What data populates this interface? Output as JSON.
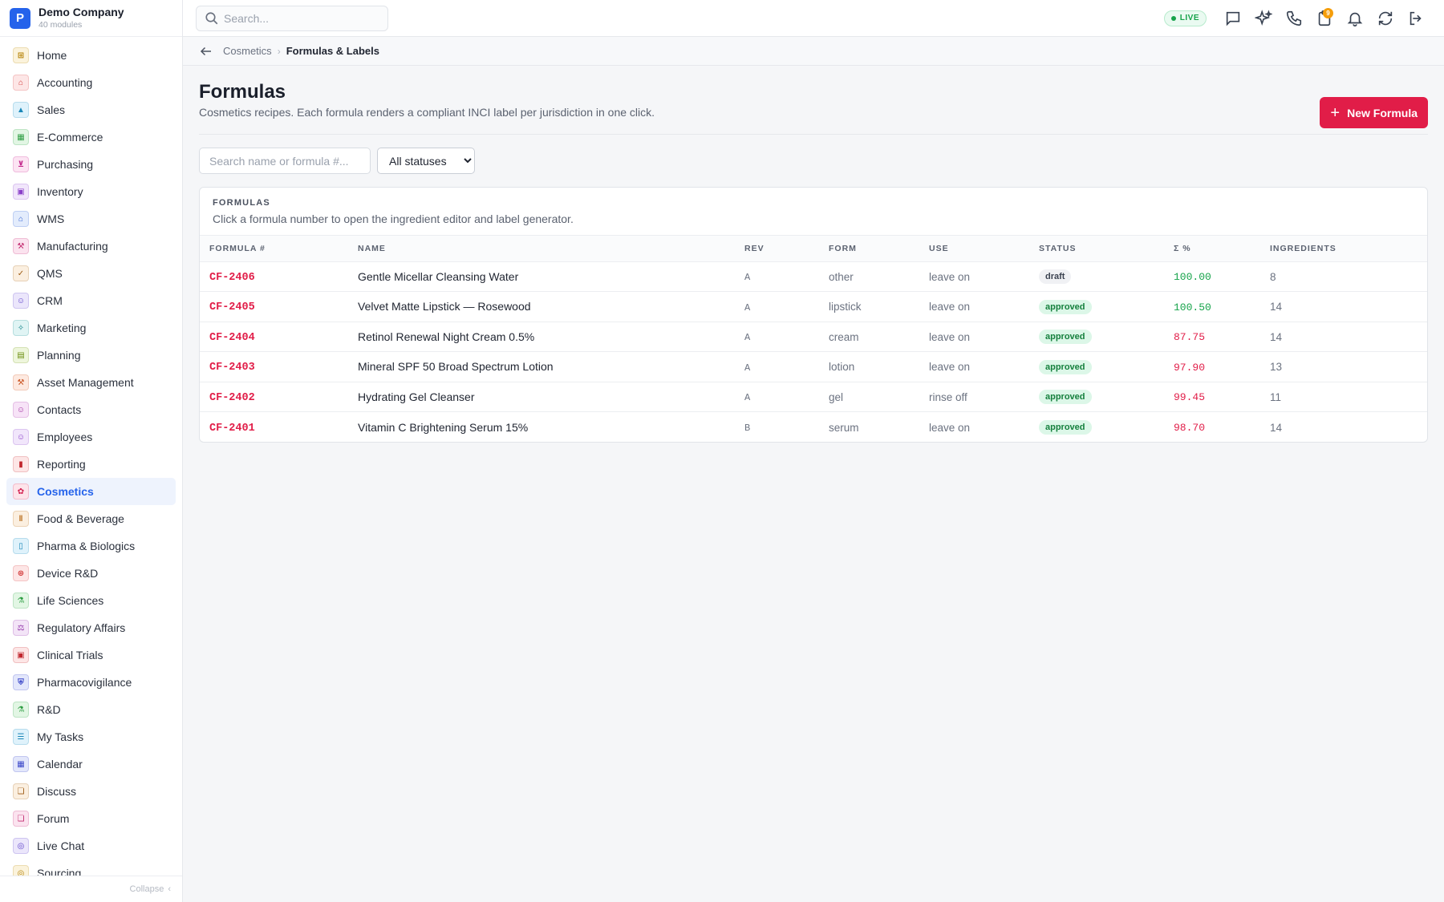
{
  "brand": {
    "initial": "P",
    "name": "Demo Company",
    "sub": "40 modules"
  },
  "sidebar": {
    "items": [
      {
        "label": "Home",
        "icon": "home-icon",
        "glyph": "⊞",
        "bg": "#fbf3dc",
        "fg": "#b58105"
      },
      {
        "label": "Accounting",
        "icon": "bank-icon",
        "glyph": "⌂",
        "bg": "#fde6e6",
        "fg": "#d23b3b"
      },
      {
        "label": "Sales",
        "icon": "sales-icon",
        "glyph": "▲",
        "bg": "#dff2fb",
        "fg": "#1a87b8"
      },
      {
        "label": "E-Commerce",
        "icon": "store-icon",
        "glyph": "▦",
        "bg": "#e2f6e4",
        "fg": "#2f9e44"
      },
      {
        "label": "Purchasing",
        "icon": "cart-icon",
        "glyph": "⊻",
        "bg": "#fce4f3",
        "fg": "#c2258a"
      },
      {
        "label": "Inventory",
        "icon": "box-icon",
        "glyph": "▣",
        "bg": "#f1e6fb",
        "fg": "#8a3fc9"
      },
      {
        "label": "WMS",
        "icon": "warehouse-icon",
        "glyph": "⌂",
        "bg": "#e3ecfc",
        "fg": "#2f5fd0"
      },
      {
        "label": "Manufacturing",
        "icon": "factory-icon",
        "glyph": "⚒",
        "bg": "#fbe3ef",
        "fg": "#c22a6f"
      },
      {
        "label": "QMS",
        "icon": "badge-check-icon",
        "glyph": "✓",
        "bg": "#fbefe0",
        "fg": "#9c5a12"
      },
      {
        "label": "CRM",
        "icon": "users-icon",
        "glyph": "☺",
        "bg": "#ebe6fb",
        "fg": "#5b3fc9"
      },
      {
        "label": "Marketing",
        "icon": "megaphone-icon",
        "glyph": "✧",
        "bg": "#e0f4f4",
        "fg": "#16858a"
      },
      {
        "label": "Planning",
        "icon": "calendar-grid-icon",
        "glyph": "▤",
        "bg": "#eef6dc",
        "fg": "#6d8f12"
      },
      {
        "label": "Asset Management",
        "icon": "tools-icon",
        "glyph": "⚒",
        "bg": "#fde9e0",
        "fg": "#c9521f"
      },
      {
        "label": "Contacts",
        "icon": "contact-card-icon",
        "glyph": "☺",
        "bg": "#f7e3f7",
        "fg": "#a0309f"
      },
      {
        "label": "Employees",
        "icon": "employee-icon",
        "glyph": "☺",
        "bg": "#f1e6fb",
        "fg": "#8a3fc9"
      },
      {
        "label": "Reporting",
        "icon": "bar-chart-icon",
        "glyph": "▮",
        "bg": "#fde6e6",
        "fg": "#c0262d"
      },
      {
        "label": "Cosmetics",
        "icon": "flower-icon",
        "glyph": "✿",
        "bg": "#fde4ea",
        "fg": "#d21f4f"
      },
      {
        "label": "Food & Beverage",
        "icon": "utensils-icon",
        "glyph": "ǁ",
        "bg": "#fbefe0",
        "fg": "#b5650f"
      },
      {
        "label": "Pharma & Biologics",
        "icon": "pill-bottle-icon",
        "glyph": "▯",
        "bg": "#dff2fb",
        "fg": "#1a87b8"
      },
      {
        "label": "Device R&D",
        "icon": "chip-icon",
        "glyph": "⊛",
        "bg": "#fde6e6",
        "fg": "#d23b3b"
      },
      {
        "label": "Life Sciences",
        "icon": "microscope-icon",
        "glyph": "⚗",
        "bg": "#e2f6e4",
        "fg": "#2f9e44"
      },
      {
        "label": "Regulatory Affairs",
        "icon": "gavel-icon",
        "glyph": "⚖",
        "bg": "#f3e4f7",
        "fg": "#8f2fa6"
      },
      {
        "label": "Clinical Trials",
        "icon": "clipboard-icon",
        "glyph": "▣",
        "bg": "#fde6e6",
        "fg": "#c0262d"
      },
      {
        "label": "Pharmacovigilance",
        "icon": "shield-icon",
        "glyph": "⛨",
        "bg": "#e3e7fb",
        "fg": "#3b47c9"
      },
      {
        "label": "R&D",
        "icon": "flask-icon",
        "glyph": "⚗",
        "bg": "#e2f6e4",
        "fg": "#2f9e44"
      },
      {
        "label": "My Tasks",
        "icon": "checklist-icon",
        "glyph": "☰",
        "bg": "#dff2fb",
        "fg": "#1a87b8"
      },
      {
        "label": "Calendar",
        "icon": "calendar-icon",
        "glyph": "▦",
        "bg": "#e3e7fb",
        "fg": "#3b47c9"
      },
      {
        "label": "Discuss",
        "icon": "chat-bubbles-icon",
        "glyph": "❏",
        "bg": "#fbefe0",
        "fg": "#9c5a12"
      },
      {
        "label": "Forum",
        "icon": "forum-icon",
        "glyph": "❏",
        "bg": "#fbe3ef",
        "fg": "#c22a6f"
      },
      {
        "label": "Live Chat",
        "icon": "headset-icon",
        "glyph": "◎",
        "bg": "#ebe6fb",
        "fg": "#5b3fc9"
      },
      {
        "label": "Sourcing",
        "icon": "sourcing-icon",
        "glyph": "◎",
        "bg": "#fbf3dc",
        "fg": "#b58105"
      }
    ],
    "active": "Cosmetics",
    "collapse_label": "Collapse"
  },
  "topbar": {
    "search_placeholder": "Search...",
    "live_label": "LIVE",
    "notification_count": "9"
  },
  "breadcrumb": {
    "parent": "Cosmetics",
    "current": "Formulas & Labels"
  },
  "page": {
    "title": "Formulas",
    "subtitle": "Cosmetics recipes. Each formula renders a compliant INCI label per jurisdiction in one click.",
    "new_button": "New Formula"
  },
  "filters": {
    "search_placeholder": "Search name or formula #...",
    "status_selected": "All statuses"
  },
  "table": {
    "label": "FORMULAS",
    "description": "Click a formula number to open the ingredient editor and label generator.",
    "columns": [
      "FORMULA #",
      "NAME",
      "REV",
      "FORM",
      "USE",
      "STATUS",
      "Σ %",
      "INGREDIENTS"
    ],
    "rows": [
      {
        "num": "CF-2406",
        "name": "Gentle Micellar Cleansing Water",
        "rev": "A",
        "form": "other",
        "use": "leave on",
        "status": "draft",
        "pct": "100.00",
        "pct_ok": true,
        "ingredients": "8"
      },
      {
        "num": "CF-2405",
        "name": "Velvet Matte Lipstick — Rosewood",
        "rev": "A",
        "form": "lipstick",
        "use": "leave on",
        "status": "approved",
        "pct": "100.50",
        "pct_ok": true,
        "ingredients": "14"
      },
      {
        "num": "CF-2404",
        "name": "Retinol Renewal Night Cream 0.5%",
        "rev": "A",
        "form": "cream",
        "use": "leave on",
        "status": "approved",
        "pct": "87.75",
        "pct_ok": false,
        "ingredients": "14"
      },
      {
        "num": "CF-2403",
        "name": "Mineral SPF 50 Broad Spectrum Lotion",
        "rev": "A",
        "form": "lotion",
        "use": "leave on",
        "status": "approved",
        "pct": "97.90",
        "pct_ok": false,
        "ingredients": "13"
      },
      {
        "num": "CF-2402",
        "name": "Hydrating Gel Cleanser",
        "rev": "A",
        "form": "gel",
        "use": "rinse off",
        "status": "approved",
        "pct": "99.45",
        "pct_ok": false,
        "ingredients": "11"
      },
      {
        "num": "CF-2401",
        "name": "Vitamin C Brightening Serum 15%",
        "rev": "B",
        "form": "serum",
        "use": "leave on",
        "status": "approved",
        "pct": "98.70",
        "pct_ok": false,
        "ingredients": "14"
      }
    ]
  }
}
